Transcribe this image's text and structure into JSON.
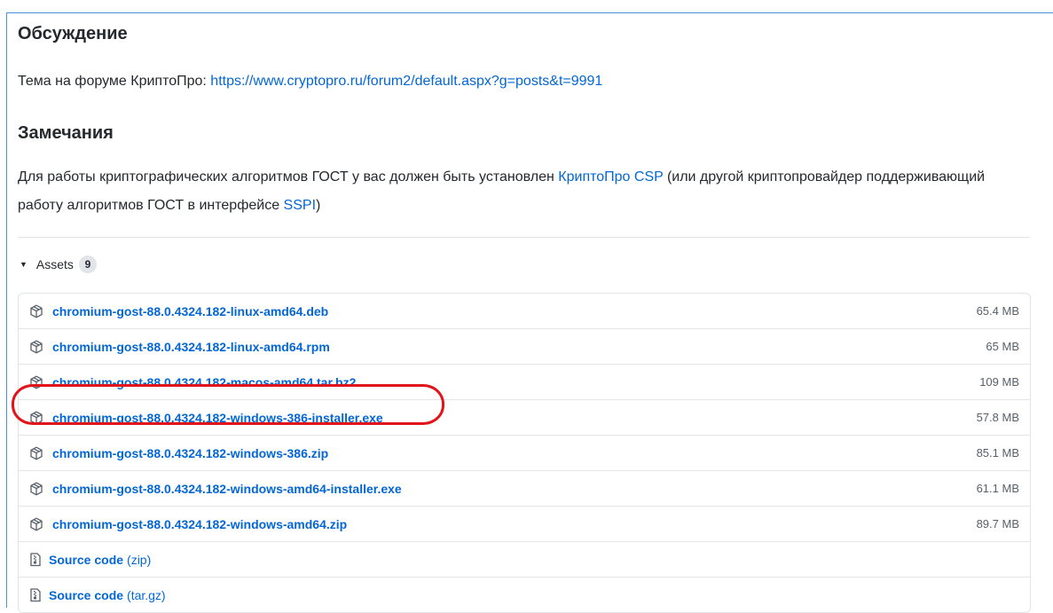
{
  "discussion": {
    "heading": "Обсуждение",
    "text": "Тема на форуме КриптоПро: ",
    "link": "https://www.cryptopro.ru/forum2/default.aspx?g=posts&t=9991"
  },
  "notes": {
    "heading": "Замечания",
    "text_1": "Для работы криптографических алгоритмов ГОСТ у вас должен быть установлен ",
    "link_1": "КриптоПро CSP",
    "text_2": " (или другой криптопровайдер поддерживающий работу алгоритмов ГОСТ в интерфейсе ",
    "link_2": "SSPI",
    "text_3": ")"
  },
  "assets": {
    "label": "Assets",
    "count": "9",
    "files": [
      {
        "name": "chromium-gost-88.0.4324.182-linux-amd64.deb",
        "size": "65.4 MB",
        "icon": "package-icon"
      },
      {
        "name": "chromium-gost-88.0.4324.182-linux-amd64.rpm",
        "size": "65 MB",
        "icon": "package-icon"
      },
      {
        "name": "chromium-gost-88.0.4324.182-macos-amd64.tar.bz2",
        "size": "109 MB",
        "icon": "package-icon"
      },
      {
        "name": "chromium-gost-88.0.4324.182-windows-386-installer.exe",
        "size": "57.8 MB",
        "icon": "package-icon"
      },
      {
        "name": "chromium-gost-88.0.4324.182-windows-386.zip",
        "size": "85.1 MB",
        "icon": "package-icon"
      },
      {
        "name": "chromium-gost-88.0.4324.182-windows-amd64-installer.exe",
        "size": "61.1 MB",
        "icon": "package-icon"
      },
      {
        "name": "chromium-gost-88.0.4324.182-windows-amd64.zip",
        "size": "89.7 MB",
        "icon": "package-icon"
      }
    ],
    "sources": [
      {
        "label": "Source code",
        "format": "(zip)",
        "icon": "file-zip-icon"
      },
      {
        "label": "Source code",
        "format": "(tar.gz)",
        "icon": "file-zip-icon"
      }
    ]
  },
  "colors": {
    "link": "#0366d6",
    "highlight": "#e1141c",
    "frame": "#4a90d9"
  }
}
